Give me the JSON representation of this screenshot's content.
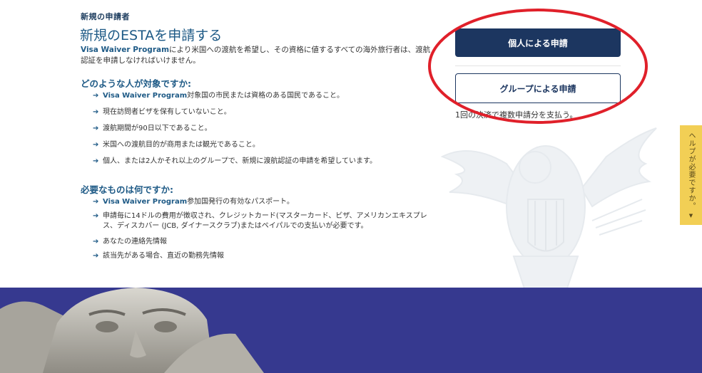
{
  "section_label": "新規の申請者",
  "title": "新規のESTAを申請する",
  "intro": {
    "program": "Visa Waiver Program",
    "text": "により米国への渡航を希望し、その資格に値するすべての海外旅行者は、渡航認証を申請しなければいけません。"
  },
  "who": {
    "heading": "どのような人が対象ですか:",
    "items": [
      {
        "program": "Visa Waiver Program",
        "text": "対象国の市民または資格のある国民であること。"
      },
      {
        "program": "",
        "text": "現在訪問者ビザを保有していないこと。"
      },
      {
        "program": "",
        "text": "渡航期間が90日以下であること。"
      },
      {
        "program": "",
        "text": "米国への渡航目的が商用または観光であること。"
      },
      {
        "program": "",
        "text": "個人、または2人かそれ以上のグループで、新規に渡航認証の申請を希望しています。"
      }
    ]
  },
  "need": {
    "heading": "必要なものは何ですか:",
    "items": [
      {
        "program": "Visa Waiver Program",
        "text": "参加国発行の有効なパスポート。"
      },
      {
        "program": "",
        "text": "申請毎に14ドルの費用が徴収され、クレジットカード(マスターカード、ビザ、アメリカンエキスプレス、ディスカバー (JCB, ダイナースクラブ)またはペイパルでの支払いが必要です。"
      },
      {
        "program": "",
        "text": "あなたの連絡先情報"
      },
      {
        "program": "",
        "text": "該当先がある場合、直近の勤務先情報"
      }
    ]
  },
  "buttons": {
    "individual": "個人による申請",
    "group": "グループによる申請",
    "group_note": "1回の決済で複数申請分を支払う。"
  },
  "help_tab": {
    "label": "ヘルプが必要ですか。",
    "caret": "▼"
  },
  "colors": {
    "primary_navy": "#1c3660",
    "link_blue": "#1e5a86",
    "highlight_red": "#e0202a",
    "help_yellow": "#f2cf55",
    "banner_blue": "#36398f"
  },
  "icons": {
    "bullet": "arrow-right-icon"
  }
}
